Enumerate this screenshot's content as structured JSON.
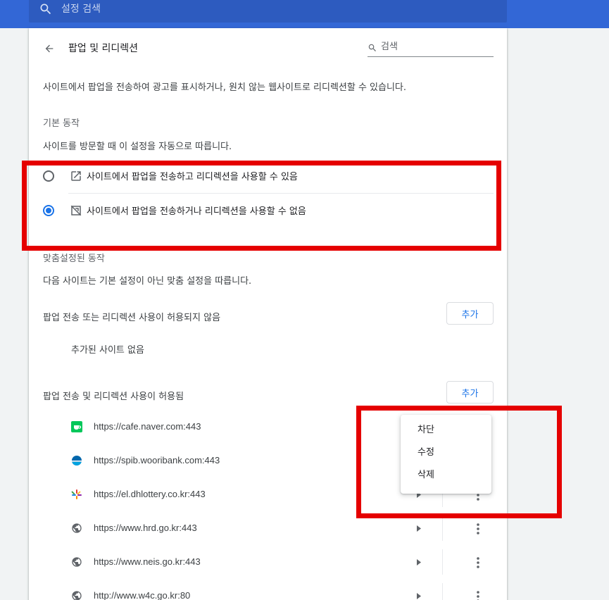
{
  "header": {
    "search_placeholder": "설정 검색"
  },
  "page": {
    "title": "팝업 및 리디렉션",
    "search_label": "검색",
    "description": "사이트에서 팝업을 전송하여 광고를 표시하거나, 원치 않는 웹사이트로 리디렉션할 수 있습니다."
  },
  "default_behavior": {
    "heading": "기본 동작",
    "subheading": "사이트를 방문할 때 이 설정을 자동으로 따릅니다.",
    "options": [
      {
        "label": "사이트에서 팝업을 전송하고 리디렉션을 사용할 수 있음",
        "checked": false,
        "icon": "open-in-new-icon"
      },
      {
        "label": "사이트에서 팝업을 전송하거나 리디렉션을 사용할 수 없음",
        "checked": true,
        "icon": "popup-blocked-icon"
      }
    ]
  },
  "custom_behavior": {
    "heading": "맞춤설정된 동작",
    "subheading": "다음 사이트는 기본 설정이 아닌 맞춤 설정을 따릅니다.",
    "blocked": {
      "label": "팝업 전송 또는 리디렉션 사용이 허용되지 않음",
      "add_label": "추가",
      "empty_text": "추가된 사이트 없음"
    },
    "allowed": {
      "label": "팝업 전송 및 리디렉션 사용이 허용됨",
      "add_label": "추가",
      "sites": [
        {
          "url": "https://cafe.naver.com:443",
          "icon": "naver-cafe-icon"
        },
        {
          "url": "https://spib.wooribank.com:443",
          "icon": "wooribank-icon"
        },
        {
          "url": "https://el.dhlottery.co.kr:443",
          "icon": "dhlottery-icon"
        },
        {
          "url": "https://www.hrd.go.kr:443",
          "icon": "globe-icon"
        },
        {
          "url": "https://www.neis.go.kr:443",
          "icon": "globe-icon"
        },
        {
          "url": "http://www.w4c.go.kr:80",
          "icon": "globe-icon"
        }
      ]
    }
  },
  "context_menu": {
    "items": [
      {
        "label": "차단"
      },
      {
        "label": "수정"
      },
      {
        "label": "삭제"
      }
    ]
  },
  "colors": {
    "accent": "#1a73e8",
    "topbar": "#3367d6",
    "highlight": "#e50000"
  }
}
